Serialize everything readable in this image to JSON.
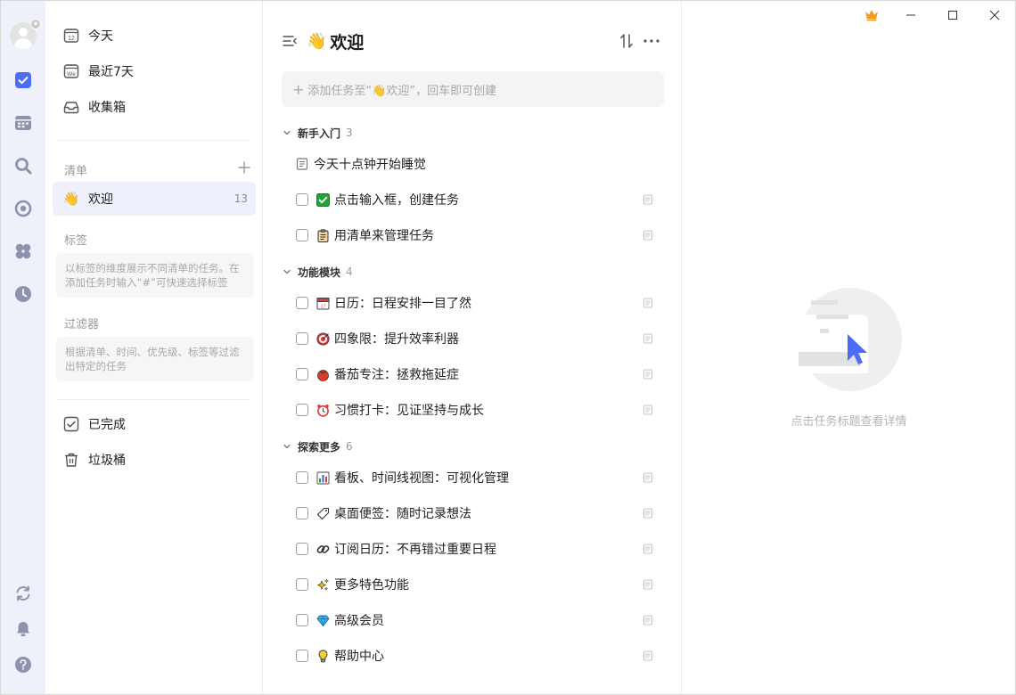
{
  "rail": {
    "icons": [
      "avatar",
      "checkbox-icon",
      "calendar-icon",
      "search-icon",
      "focus-icon",
      "matrix-icon",
      "clock-icon",
      "sync-icon",
      "bell-icon",
      "help-icon"
    ],
    "accent": "#4a6cf7"
  },
  "sidebar": {
    "smart_lists": [
      {
        "label": "今天",
        "icon": "calendar-today-icon",
        "day": "12"
      },
      {
        "label": "最近7天",
        "icon": "calendar-week-icon",
        "day": "We"
      },
      {
        "label": "收集箱",
        "icon": "inbox-icon"
      }
    ],
    "lists_title": "清单",
    "lists": [
      {
        "label": "欢迎",
        "emoji": "👋",
        "count": "13"
      }
    ],
    "tags_title": "标签",
    "tags_hint": "以标签的维度展示不同清单的任务。在添加任务时输入“#”可快速选择标签",
    "filters_title": "过滤器",
    "filters_hint": "根据清单、时间、优先级、标签等过滤出特定的任务",
    "bottom": [
      {
        "label": "已完成",
        "icon": "completed-icon"
      },
      {
        "label": "垃圾桶",
        "icon": "trash-icon"
      }
    ]
  },
  "main": {
    "title": "欢迎",
    "title_emoji": "👋",
    "add_placeholder": "添加任务至“👋欢迎”，回车即可创建",
    "groups": [
      {
        "name": "新手入门",
        "count": "3",
        "tasks": [
          {
            "title": "今天十点钟开始睡觉",
            "type": "note",
            "emoji": ""
          },
          {
            "title": "点击输入框，创建任务",
            "type": "task",
            "emoji": "✅"
          },
          {
            "title": "用清单来管理任务",
            "type": "task",
            "emoji": "📋"
          }
        ]
      },
      {
        "name": "功能模块",
        "count": "4",
        "tasks": [
          {
            "title": "日历：日程安排一目了然",
            "type": "task",
            "emoji": "📅"
          },
          {
            "title": "四象限：提升效率利器",
            "type": "task",
            "emoji": "🎯"
          },
          {
            "title": "番茄专注：拯救拖延症",
            "type": "task",
            "emoji": "🍅"
          },
          {
            "title": "习惯打卡：见证坚持与成长",
            "type": "task",
            "emoji": "⏰"
          }
        ]
      },
      {
        "name": "探索更多",
        "count": "6",
        "tasks": [
          {
            "title": "看板、时间线视图：可视化管理",
            "type": "task",
            "emoji": "📊"
          },
          {
            "title": "桌面便签：随时记录想法",
            "type": "task",
            "emoji": "🏷"
          },
          {
            "title": "订阅日历：不再错过重要日程",
            "type": "task",
            "emoji": "🔗"
          },
          {
            "title": "更多特色功能",
            "type": "task",
            "emoji": "✨"
          },
          {
            "title": "高级会员",
            "type": "task",
            "emoji": "💎"
          },
          {
            "title": "帮助中心",
            "type": "task",
            "emoji": "💡"
          }
        ]
      }
    ]
  },
  "detail": {
    "empty_text": "点击任务标题查看详情"
  },
  "window": {
    "controls": [
      "crown-icon",
      "minimize-icon",
      "maximize-icon",
      "close-icon"
    ],
    "crown_color": "#f0a020"
  }
}
